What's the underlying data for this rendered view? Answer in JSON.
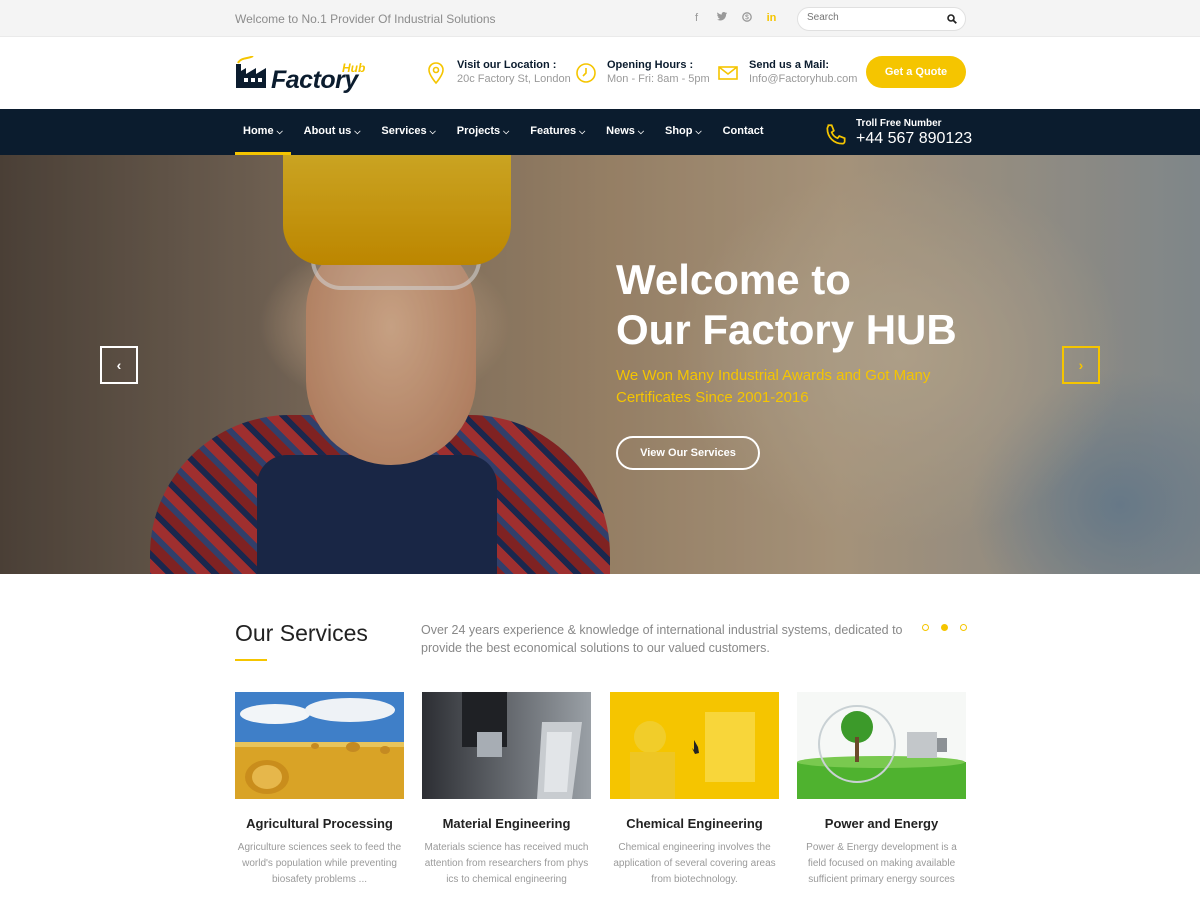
{
  "topbar": {
    "welcome": "Welcome to No.1 Provider Of Industrial Solutions",
    "search_placeholder": "Search",
    "social": [
      "facebook-icon",
      "twitter-icon",
      "skype-icon",
      "linkedin-icon"
    ]
  },
  "header": {
    "logo_main": "Factory",
    "logo_sub": "Hub",
    "location_title": "Visit our Location :",
    "location_text": "20c Factory St, London",
    "hours_title": "Opening Hours :",
    "hours_text": "Mon - Fri: 8am - 5pm",
    "mail_title": "Send us a Mail:",
    "mail_text": "Info@Factoryhub.com",
    "quote_button": "Get a Quote"
  },
  "nav": {
    "items": [
      {
        "label": "Home"
      },
      {
        "label": "About us"
      },
      {
        "label": "Services"
      },
      {
        "label": "Projects"
      },
      {
        "label": "Features"
      },
      {
        "label": "News"
      },
      {
        "label": "Shop"
      },
      {
        "label": "Contact"
      }
    ],
    "toll_label": "Troll Free Number",
    "toll_number": "+44 567 890123"
  },
  "hero": {
    "title_line1": "Welcome to",
    "title_line2": "Our Factory HUB",
    "subtitle": "We Won Many Industrial Awards and Got Many Certificates Since 2001-2016",
    "button": "View Our Services"
  },
  "services": {
    "title": "Our Services",
    "description": "Over 24 years experience & knowledge of international industrial systems, dedicated to provide the best economical solutions to our valued customers.",
    "cards": [
      {
        "name": "Agricultural Processing",
        "text": "Agriculture sciences seek to feed the world's population while preventing biosafety problems ..."
      },
      {
        "name": "Material Engineering",
        "text": "Materials science has received much attention from researchers from phys ics to chemical engineering"
      },
      {
        "name": "Chemical Engineering",
        "text": "Chemical engineering involves the application of several covering areas from biotechnology."
      },
      {
        "name": "Power and Energy",
        "text": "Power & Energy development is a field focused on making available sufficient primary energy sources"
      }
    ]
  },
  "colors": {
    "accent": "#f5c500",
    "navy": "#0b1c2e"
  }
}
